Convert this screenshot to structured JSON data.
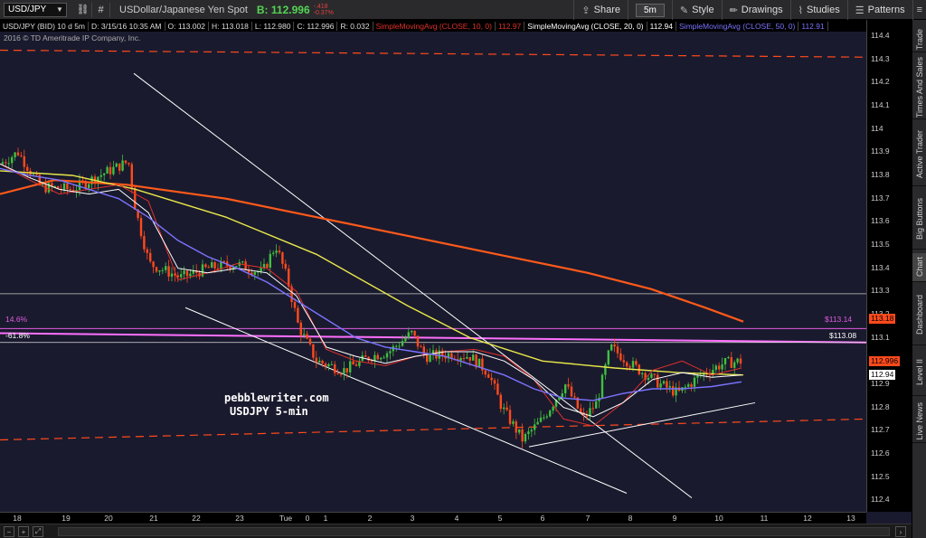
{
  "toolbar": {
    "symbol": "USD/JPY",
    "description": "USDollar/Japanese Yen Spot",
    "bid_label": "B:",
    "bid_value": "112.996",
    "change_top": "-.418",
    "change_bottom": "-0.37%",
    "share_label": "Share",
    "timeframe": "5m",
    "style_label": "Style",
    "drawings_label": "Drawings",
    "studies_label": "Studies",
    "patterns_label": "Patterns"
  },
  "inforow": {
    "symbol": "USD/JPY (BID) 10 d 5m",
    "date": "D: 3/15/16 10:35 AM",
    "open": "O: 113.002",
    "high": "H: 113.018",
    "low": "L: 112.980",
    "close": "C: 112.996",
    "range": "R: 0.032",
    "ma10": "SimpleMovingAvg (CLOSE, 10, 0)",
    "ma10_val": "112.97",
    "ma20": "SimpleMovingAvg (CLOSE, 20, 0)",
    "ma20_val": "112.94",
    "ma50": "SimpleMovingAvg (CLOSE, 50, 0)",
    "ma50_val": "112.91"
  },
  "copyright": "2016 © TD Ameritrade IP Company, Inc.",
  "annotations": {
    "site": "pebblewriter.com",
    "subtitle": "USDJPY 5-min",
    "fib_146": "14.6%",
    "fib_618": "-61.8%",
    "level_11314": "$113.14",
    "level_11308": "$113.08"
  },
  "yaxis": {
    "ticks": [
      "114.4",
      "114.3",
      "114.2",
      "114.1",
      "114",
      "113.9",
      "113.8",
      "113.7",
      "113.6",
      "113.5",
      "113.4",
      "113.3",
      "113.2",
      "113.1",
      "113",
      "112.9",
      "112.8",
      "112.7",
      "112.6",
      "112.5",
      "112.4"
    ],
    "tag_11318": "113.18",
    "tag_11299": "112.996",
    "tag_11294": "112.94",
    "tag_11314": "113.14",
    "tag_11308": "113.08"
  },
  "xaxis": {
    "ticks": [
      "18",
      "19",
      "20",
      "21",
      "22",
      "23",
      "Tue",
      "0",
      "1",
      "2",
      "3",
      "4",
      "5",
      "6",
      "7",
      "8",
      "9",
      "10",
      "11",
      "12",
      "13"
    ]
  },
  "sidebar": {
    "tabs": [
      "Trade",
      "Times And Sales",
      "Active Trader",
      "Big Buttons",
      "Chart",
      "Dashboard",
      "Level II",
      "Live News"
    ]
  },
  "colors": {
    "background": "#1a1a2e",
    "candle_up": "#3fbf3f",
    "candle_down": "#ff4a1c",
    "ma10": "#e0302a",
    "ma20": "#ffffff",
    "ma50": "#7b73ff",
    "ma200": "#ff5a1a",
    "ma100": "#e8e84a",
    "fib": "#e05ae0"
  },
  "chart_data": {
    "type": "candlestick",
    "ylim": [
      112.35,
      114.42
    ],
    "series": [
      {
        "name": "SimpleMovingAvg (CLOSE, 10, 0)",
        "values": [
          113.85,
          113.78,
          113.72,
          113.74,
          113.76,
          113.69,
          113.35,
          113.38,
          113.42,
          113.4,
          113.3,
          113.05,
          113.0,
          112.98,
          113.02,
          113.04,
          113.05,
          113.02,
          112.92,
          112.75,
          112.72,
          112.82,
          112.96,
          113.0,
          112.94,
          112.97
        ]
      },
      {
        "name": "SimpleMovingAvg (CLOSE, 20, 0)",
        "values": [
          113.85,
          113.79,
          113.74,
          113.72,
          113.74,
          113.64,
          113.4,
          113.38,
          113.4,
          113.38,
          113.28,
          113.06,
          113.02,
          112.99,
          113.02,
          113.04,
          113.04,
          113.0,
          112.92,
          112.8,
          112.76,
          112.82,
          112.92,
          112.95,
          112.93,
          112.94
        ]
      },
      {
        "name": "SimpleMovingAvg (CLOSE, 50, 0)",
        "values": [
          113.83,
          113.8,
          113.78,
          113.74,
          113.7,
          113.62,
          113.52,
          113.45,
          113.4,
          113.34,
          113.26,
          113.18,
          113.1,
          113.06,
          113.04,
          113.02,
          112.98,
          112.94,
          112.88,
          112.84,
          112.83,
          112.86,
          112.88,
          112.88,
          112.89,
          112.91
        ]
      }
    ],
    "x": [
      "18",
      "19",
      "20",
      "21",
      "22",
      "23",
      "Tue",
      "0",
      "1",
      "2",
      "3",
      "4",
      "5",
      "6",
      "7",
      "8",
      "9",
      "10"
    ]
  }
}
